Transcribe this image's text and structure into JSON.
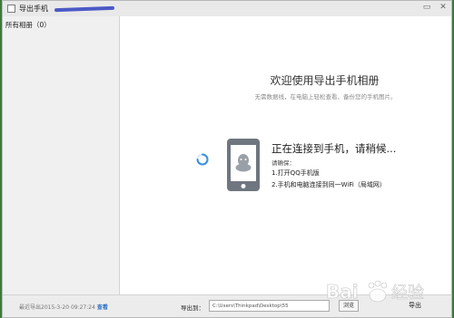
{
  "window": {
    "title": "导出手机",
    "controls": {
      "minimize": "▭",
      "close": "✕"
    }
  },
  "sidebar": {
    "header": "所有相册（0）"
  },
  "main": {
    "welcome_title": "欢迎使用导出手机相册",
    "welcome_subtitle": "无需数据线，在电脑上轻松查看、备份您的手机图片。",
    "status": "正在连接到手机，请稍候...",
    "confirm_title": "请确保：",
    "steps": [
      "1.打开QQ手机版",
      "2.手机和电脑连接到同一WiFi（局域网）"
    ]
  },
  "bottom": {
    "last_export_text": "最近导出2015-3-20 09:27:24",
    "view_link": "查看",
    "export_to_label": "导出到：",
    "path_value": "C:\\Users\\Thinkpad\\Desktop\\55",
    "browse_label": "浏览",
    "export_label": "导出"
  },
  "colors": {
    "accent": "#2a6fc9",
    "spinner": "#3a8fe0",
    "phone_icon": "#6f7680"
  },
  "icons": {
    "phone": "phone-qq-icon",
    "spinner": "loading-spinner-icon"
  }
}
